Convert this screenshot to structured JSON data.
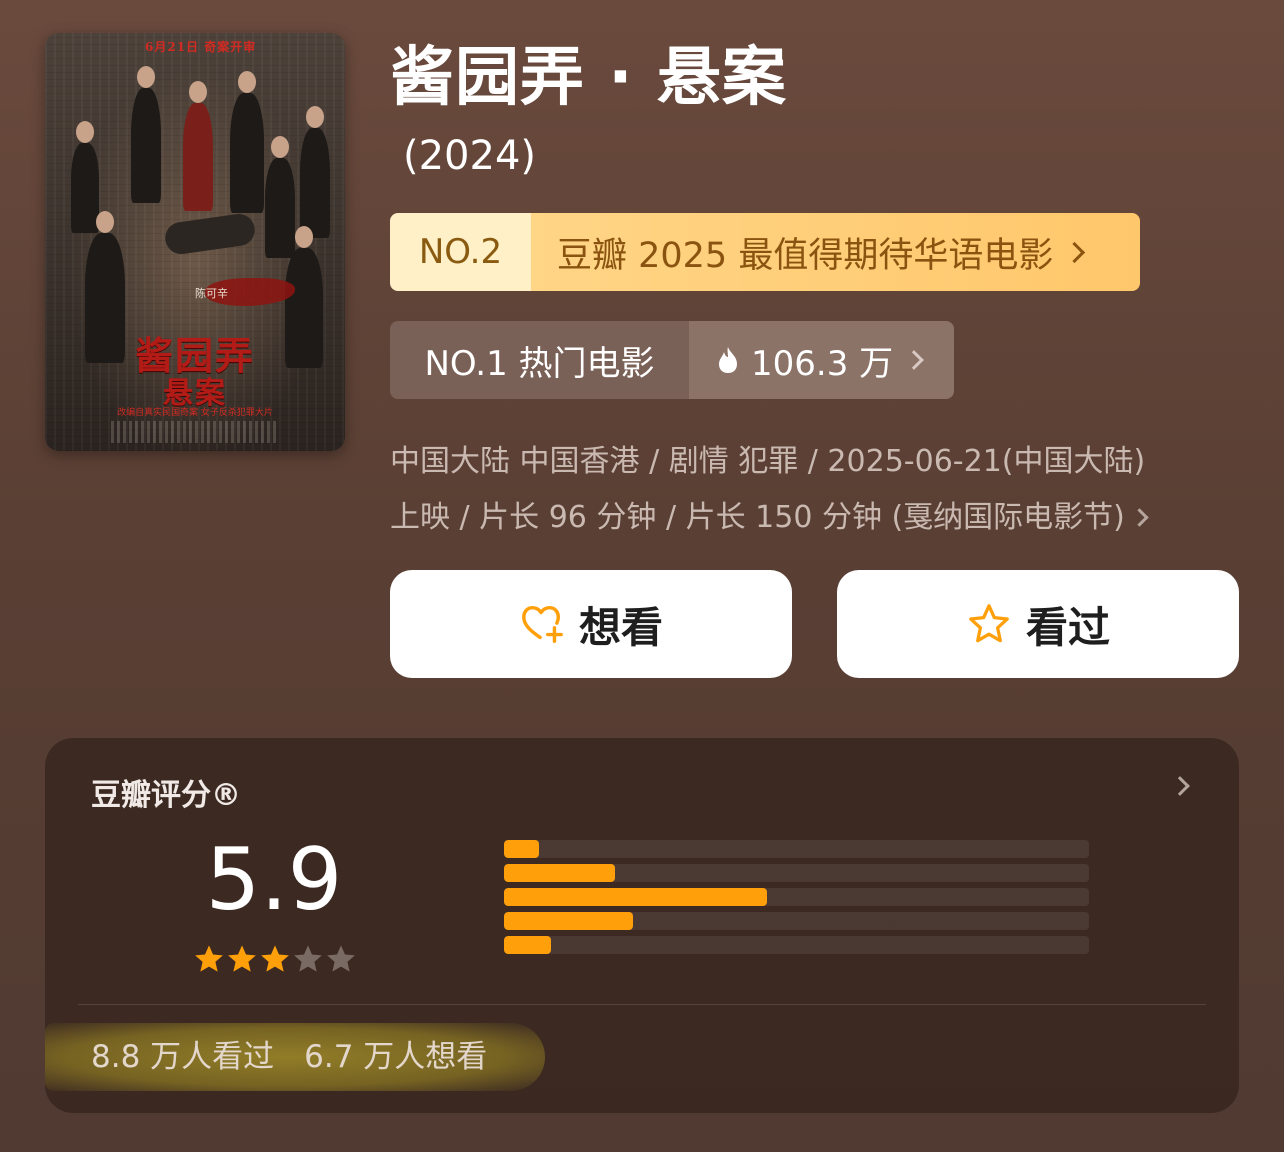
{
  "poster": {
    "top_text": "6月21日 奇案开审",
    "actor": "陈可辛",
    "title_line1": "酱园弄",
    "title_line2": "悬案",
    "tagline": "改编自真实民国奇案 女子反杀犯罪大片"
  },
  "movie": {
    "title": "酱园弄 · 悬案",
    "year": "(2024)"
  },
  "rank_expected": {
    "no": "NO.2",
    "label": "豆瓣 2025 最值得期待华语电影"
  },
  "rank_hot": {
    "no": "NO.1 热门电影",
    "heat": "106.3 万"
  },
  "meta": {
    "line1": "中国大陆 中国香港 / 剧情 犯罪 / 2025-06-21(中国大陆)",
    "line2": "上映 / 片长 96 分钟 / 片长 150 分钟 (戛纳国际电影节)"
  },
  "actions": {
    "want_label": "想看",
    "seen_label": "看过"
  },
  "rating": {
    "title": "豆瓣评分®",
    "score": "5.9",
    "stars_filled": 3,
    "stars_total": 5,
    "distribution": [
      {
        "stars": 5,
        "fraction": 0.06
      },
      {
        "stars": 4,
        "fraction": 0.19
      },
      {
        "stars": 3,
        "fraction": 0.45
      },
      {
        "stars": 2,
        "fraction": 0.22
      },
      {
        "stars": 1,
        "fraction": 0.08
      }
    ],
    "seen_count": "8.8 万人看过",
    "want_count": "6.7 万人想看"
  },
  "colors": {
    "accent_orange": "#ff9f0a",
    "gold_badge_bg": "#ffc76b",
    "background": "#5a3f34"
  }
}
